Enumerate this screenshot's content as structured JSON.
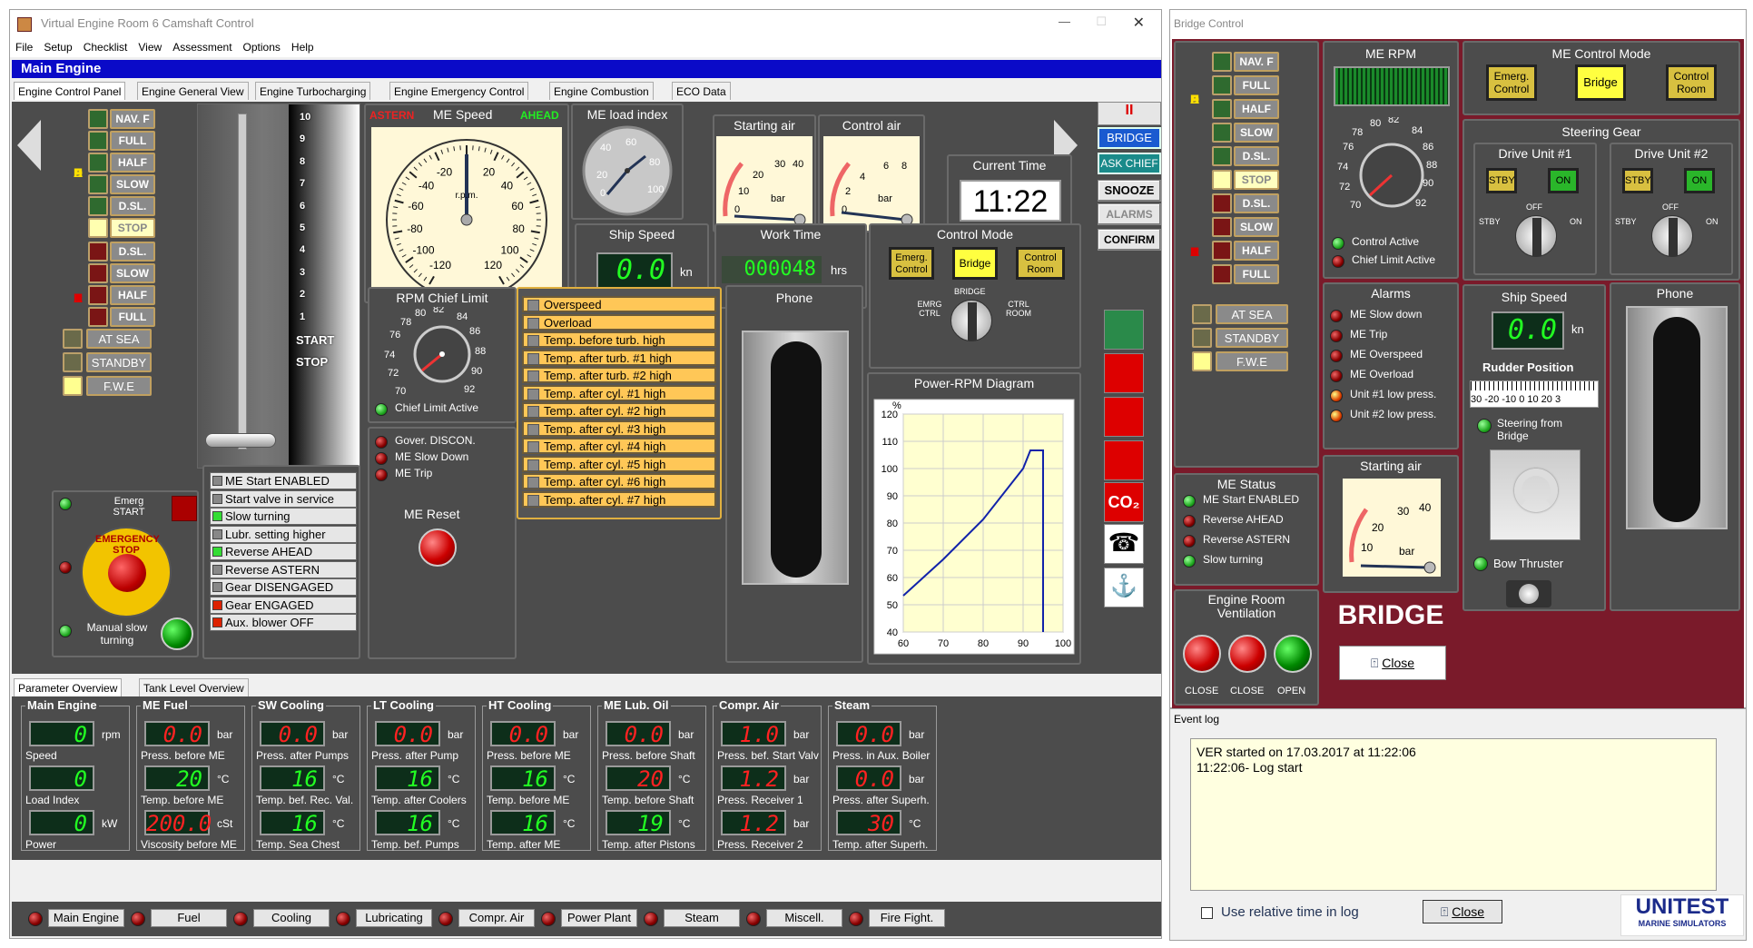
{
  "window": {
    "title": "Virtual Engine Room 6 Camshaft Control",
    "menu": [
      "File",
      "Setup",
      "Checklist",
      "View",
      "Assessment",
      "Options",
      "Help"
    ],
    "section": "Main Engine"
  },
  "tabs": [
    "Engine Control Panel",
    "Engine General View",
    "Engine Turbocharging",
    "Engine Emergency Control",
    "Engine Combustion",
    "ECO Data"
  ],
  "side_buttons": {
    "bridge": "BRIDGE",
    "ask_chief": "ASK CHIEF",
    "snooze": "SNOOZE",
    "alarms": "ALARMS",
    "confirm": "CONFIRM",
    "pause": "II"
  },
  "telegraph": {
    "ahead": "AHEAD",
    "astern": "ASTERN",
    "items": [
      "NAV. F",
      "FULL",
      "HALF",
      "SLOW",
      "D.SL.",
      "STOP",
      "D.SL.",
      "SLOW",
      "HALF",
      "FULL"
    ],
    "modes": [
      "AT SEA",
      "STANDBY",
      "F.W.E"
    ]
  },
  "lever_scale": [
    "10",
    "9",
    "8",
    "7",
    "6",
    "5",
    "4",
    "3",
    "2",
    "1",
    "START",
    "STOP"
  ],
  "emergency": {
    "label": "Emerg START",
    "button": "EMERGENCY STOP",
    "manual": "Manual slow turning"
  },
  "me_speed": {
    "title": "ME Speed",
    "astern": "ASTERN",
    "ahead": "AHEAD",
    "unit": "r.p.m."
  },
  "me_load": {
    "title": "ME load index"
  },
  "starting_air": {
    "title": "Starting air",
    "unit": "bar"
  },
  "control_air": {
    "title": "Control air",
    "unit": "bar"
  },
  "current_time": {
    "title": "Current Time",
    "value": "11:22"
  },
  "ship_speed": {
    "title": "Ship Speed",
    "value": "0.0",
    "unit": "kn"
  },
  "work_time": {
    "title": "Work Time",
    "value": "000048",
    "unit": "hrs"
  },
  "control_mode": {
    "title": "Control Mode",
    "btn": [
      "Emerg. Control",
      "Bridge",
      "Control Room"
    ],
    "sw": [
      "EMRG CTRL",
      "BRIDGE",
      "CTRL ROOM"
    ]
  },
  "rpm_chief": {
    "title": "RPM Chief Limit",
    "active": "Chief Limit Active"
  },
  "gover": {
    "items": [
      "Gover. DISCON.",
      "ME Slow Down",
      "ME Trip"
    ],
    "reset": "ME Reset"
  },
  "alarms_list": [
    "Overspeed",
    "Overload",
    "Temp. before turb. high",
    "Temp. after turb. #1 high",
    "Temp. after turb. #2 high",
    "Temp. after cyl. #1 high",
    "Temp. after cyl. #2 high",
    "Temp. after cyl. #3 high",
    "Temp. after cyl. #4 high",
    "Temp. after cyl. #5 high",
    "Temp. after cyl. #6 high",
    "Temp. after cyl. #7 high"
  ],
  "status_list": [
    {
      "t": "ME Start ENABLED",
      "c": ""
    },
    {
      "t": "Start valve in service",
      "c": ""
    },
    {
      "t": "Slow turning",
      "c": "g"
    },
    {
      "t": "Lubr. setting higher",
      "c": ""
    },
    {
      "t": "Reverse AHEAD",
      "c": "g"
    },
    {
      "t": "Reverse ASTERN",
      "c": ""
    },
    {
      "t": "Gear DISENGAGED",
      "c": ""
    },
    {
      "t": "Gear ENGAGED",
      "c": "r"
    },
    {
      "t": "Aux. blower OFF",
      "c": "r"
    }
  ],
  "phone": "Phone",
  "power_rpm": {
    "title": "Power-RPM Diagram",
    "ylabel": "%",
    "y": [
      "120",
      "110",
      "100",
      "90",
      "80",
      "70",
      "60",
      "50",
      "40"
    ],
    "x": [
      "60",
      "70",
      "80",
      "90",
      "100"
    ]
  },
  "bottom_tabs": [
    "Parameter Overview",
    "Tank Level Overview"
  ],
  "params": [
    {
      "title": "Main Engine",
      "rows": [
        {
          "v": "0",
          "u": "rpm",
          "l": "Speed"
        },
        {
          "v": "0",
          "u": "",
          "l": "Load Index"
        },
        {
          "v": "0",
          "u": "kW",
          "l": "Power"
        }
      ]
    },
    {
      "title": "ME Fuel",
      "rows": [
        {
          "v": "0.0",
          "u": "bar",
          "l": "Press. before ME",
          "r": 1
        },
        {
          "v": "20",
          "u": "°C",
          "l": "Temp. before ME"
        },
        {
          "v": "200.0",
          "u": "cSt",
          "l": "Viscosity before ME",
          "r": 1
        }
      ]
    },
    {
      "title": "SW Cooling",
      "rows": [
        {
          "v": "0.0",
          "u": "bar",
          "l": "Press. after Pumps",
          "r": 1
        },
        {
          "v": "16",
          "u": "°C",
          "l": "Temp. bef. Rec. Val."
        },
        {
          "v": "16",
          "u": "°C",
          "l": "Temp. Sea Chest"
        }
      ]
    },
    {
      "title": "LT Cooling",
      "rows": [
        {
          "v": "0.0",
          "u": "bar",
          "l": "Press. after Pump",
          "r": 1
        },
        {
          "v": "16",
          "u": "°C",
          "l": "Temp. after Coolers"
        },
        {
          "v": "16",
          "u": "°C",
          "l": "Temp. bef. Pumps"
        }
      ]
    },
    {
      "title": "HT Cooling",
      "rows": [
        {
          "v": "0.0",
          "u": "bar",
          "l": "Press. before ME",
          "r": 1
        },
        {
          "v": "16",
          "u": "°C",
          "l": "Temp. before ME"
        },
        {
          "v": "16",
          "u": "°C",
          "l": "Temp. after ME"
        }
      ]
    },
    {
      "title": "ME Lub. Oil",
      "rows": [
        {
          "v": "0.0",
          "u": "bar",
          "l": "Press. before Shaft",
          "r": 1
        },
        {
          "v": "20",
          "u": "°C",
          "l": "Temp. before Shaft",
          "r": 1
        },
        {
          "v": "19",
          "u": "°C",
          "l": "Temp. after Pistons"
        }
      ]
    },
    {
      "title": "Compr. Air",
      "rows": [
        {
          "v": "1.0",
          "u": "bar",
          "l": "Press. bef. Start Valv",
          "r": 1
        },
        {
          "v": "1.2",
          "u": "bar",
          "l": "Press. Receiver 1",
          "r": 1
        },
        {
          "v": "1.2",
          "u": "bar",
          "l": "Press. Receiver 2",
          "r": 1
        }
      ]
    },
    {
      "title": "Steam",
      "rows": [
        {
          "v": "0.0",
          "u": "bar",
          "l": "Press. in Aux. Boiler",
          "r": 1
        },
        {
          "v": "0.0",
          "u": "bar",
          "l": "Press. after Superh.",
          "r": 1
        },
        {
          "v": "30",
          "u": "°C",
          "l": "Temp. after Superh.",
          "r": 1
        }
      ]
    }
  ],
  "bottom_buttons": [
    "Main Engine",
    "Fuel",
    "Cooling",
    "Lubricating",
    "Compr. Air",
    "Power Plant",
    "Steam",
    "Miscell.",
    "Fire Fight."
  ],
  "bridge": {
    "title": "Bridge Control",
    "me_rpm": "ME RPM",
    "ctrl_active": "Control Active",
    "chief_active": "Chief Limit Active",
    "ctrl_mode": {
      "title": "ME Control Mode",
      "btn": [
        "Emerg. Control",
        "Bridge",
        "Control Room"
      ]
    },
    "steering": {
      "title": "Steering Gear",
      "du1": "Drive Unit #1",
      "du2": "Drive Unit #2",
      "stby": "STBY",
      "on": "ON",
      "off": "OFF"
    },
    "alarms": {
      "title": "Alarms",
      "items": [
        "ME Slow down",
        "ME Trip",
        "ME Overspeed",
        "ME Overload",
        "Unit #1 low press.",
        "Unit #2 low press."
      ]
    },
    "ship_speed": {
      "title": "Ship Speed",
      "value": "0.0",
      "unit": "kn"
    },
    "phone": "Phone",
    "rudder": "Rudder Position",
    "rudder_scale": "30 -20 -10  0  10  20  3",
    "steer_bridge": "Steering from Bridge",
    "bow": "Bow Thruster",
    "starting_air": "Starting air",
    "status": {
      "title": "ME Status",
      "items": [
        "ME Start ENABLED",
        "Reverse AHEAD",
        "Reverse ASTERN",
        "Slow turning"
      ]
    },
    "vent": {
      "title": "Engine Room Ventilation",
      "items": [
        "CLOSE",
        "CLOSE",
        "OPEN"
      ]
    },
    "big": "BRIDGE",
    "close": "Close"
  },
  "eventlog": {
    "title": "Event log",
    "lines": [
      "VER started on 17.03.2017 at 11:22:06",
      "11:22:06- Log start"
    ],
    "check": "Use relative time in log",
    "close": "Close"
  },
  "logo": {
    "brand": "UNITEST",
    "sub": "MARINE SIMULATORS"
  }
}
